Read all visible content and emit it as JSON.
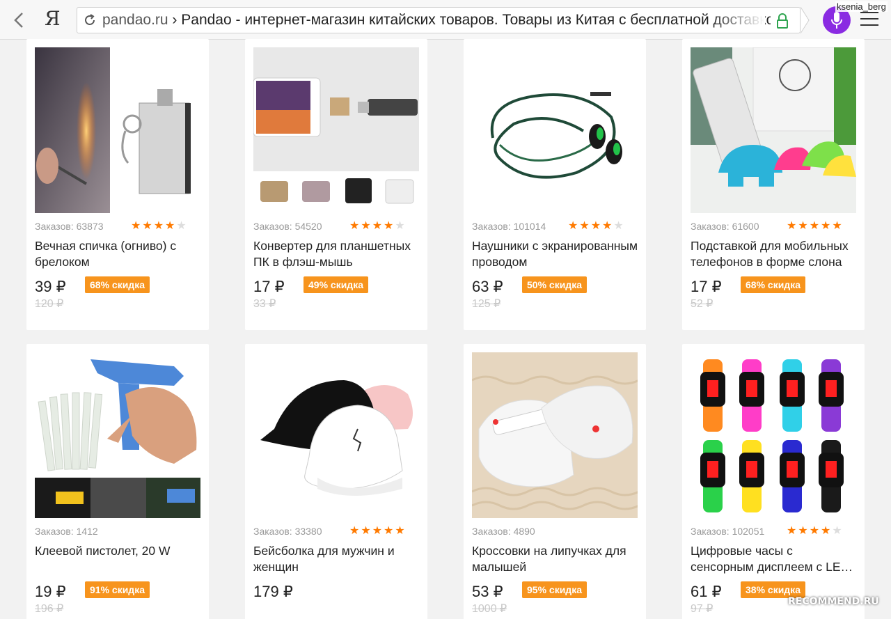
{
  "browser": {
    "logo": "Я",
    "url_domain": "pandao.ru",
    "url_separator": " › ",
    "url_title": "Pandao - интернет-магазин китайских товаров. Товары из Китая с бесплатной доставкой",
    "username": "ksenia_berg",
    "voice_color": "#8a2be2",
    "lock_color": "#2ea44f"
  },
  "products": [
    {
      "orders": "Заказов: 63873",
      "rating": "★★★★",
      "title": "Вечная спичка (огниво) с брелоком",
      "price": "39 ₽",
      "discount": "68% скидка",
      "old_price": "120 ₽"
    },
    {
      "orders": "Заказов: 54520",
      "rating": "★★★★",
      "title": "Конвертер для планшетных ПК в флэш-мышь",
      "price": "17 ₽",
      "discount": "49% скидка",
      "old_price": "33 ₽"
    },
    {
      "orders": "Заказов: 101014",
      "rating": "★★★★",
      "title": "Наушники с экранированным проводом",
      "price": "63 ₽",
      "discount": "50% скидка",
      "old_price": "125 ₽"
    },
    {
      "orders": "Заказов: 61600",
      "rating": "★★★★",
      "title": "Подставкой для мобильных телефонов в форме слона",
      "price": "17 ₽",
      "discount": "68% скидка",
      "old_price": "52 ₽"
    },
    {
      "orders": "Заказов: 1412",
      "rating": "",
      "title": "Клеевой пистолет, 20 W",
      "price": "19 ₽",
      "discount": "91% скидка",
      "old_price": "196 ₽"
    },
    {
      "orders": "Заказов: 33380",
      "rating": "★★★★★",
      "title": "Бейсболка для мужчин и женщин",
      "price": "179 ₽",
      "discount": "",
      "old_price": ""
    },
    {
      "orders": "Заказов: 4890",
      "rating": "",
      "title": "Кроссовки на липучках для малышей",
      "price": "53 ₽",
      "discount": "95% скидка",
      "old_price": "1000 ₽"
    },
    {
      "orders": "Заказов: 102051",
      "rating": "★★★★",
      "title": "Цифровые часы с сенсорным дисплеем с LE…",
      "price": "61 ₽",
      "discount": "38% скидка",
      "old_price": "97 ₽"
    }
  ],
  "watermark": "RECOMMEND.RU",
  "colors": {
    "badge": "#f7941d",
    "star": "#ff7a00"
  }
}
